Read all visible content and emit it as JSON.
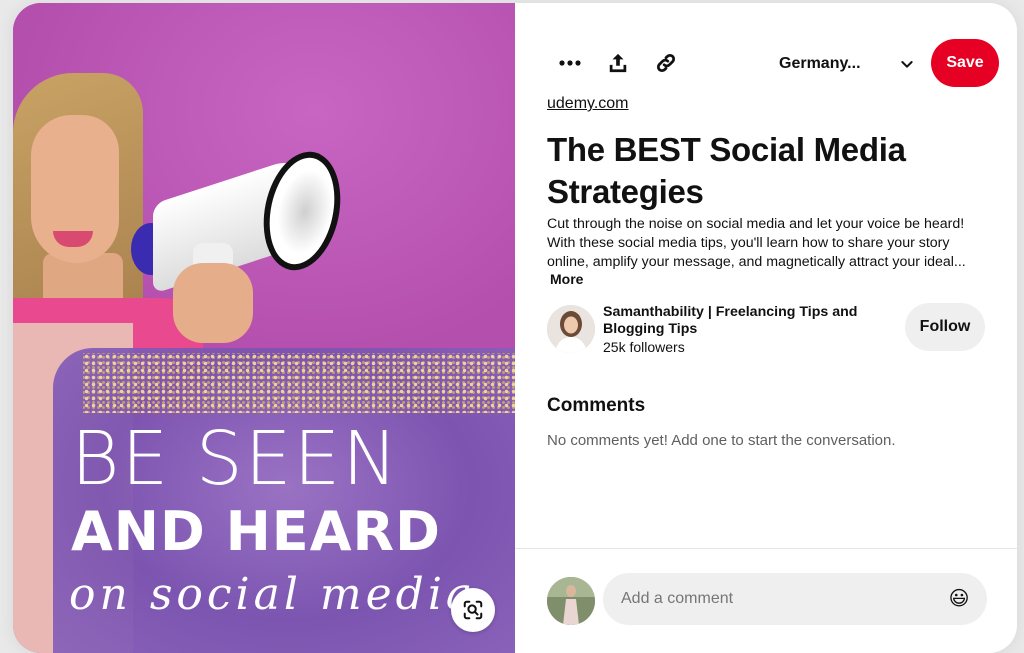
{
  "pin": {
    "image": {
      "headline_line1": "BE SEEN",
      "headline_line2": "AND HEARD",
      "headline_line3": "on social media"
    },
    "domain": "udemy.com",
    "title": "The BEST Social Media Strategies",
    "description": "Cut through the noise on social media and let your voice be heard! With these social media tips, you'll learn how to share your story online, amplify your message, and magnetically attract your ideal...",
    "more_label": "More"
  },
  "toolbar": {
    "more_icon": "ellipsis-icon",
    "share_icon": "share-upload-icon",
    "link_icon": "link-icon",
    "board_name": "Germany...",
    "dropdown_icon": "chevron-down-icon",
    "save_label": "Save"
  },
  "creator": {
    "name": "Samanthability | Freelancing Tips and Blogging Tips",
    "followers": "25k followers",
    "follow_label": "Follow"
  },
  "comments": {
    "heading": "Comments",
    "empty_text": "No comments yet! Add one to start the conversation.",
    "input_placeholder": "Add a comment",
    "emoji": "😃"
  },
  "colors": {
    "save_red": "#e60023",
    "follow_gray": "#efefef",
    "input_gray": "#efefef"
  }
}
